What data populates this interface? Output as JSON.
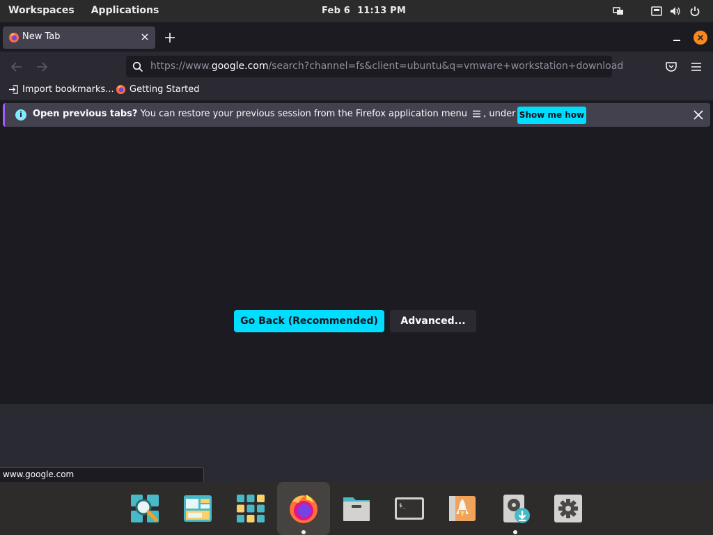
{
  "topbar": {
    "workspaces": "Workspaces",
    "applications": "Applications",
    "date": "Feb 6",
    "time": "11:13 PM"
  },
  "tab": {
    "title": "New Tab"
  },
  "urlbar": {
    "prefix": "https://www.",
    "host": "google.com",
    "path": "/search?channel=fs&client=ubuntu&q=vmware+workstation+download"
  },
  "bookmarks": {
    "import": "Import bookmarks...",
    "getting_started": "Getting Started"
  },
  "notice": {
    "bold": "Open previous tabs?",
    "text_before": " You can restore your previous session from the Firefox application menu ",
    "text_after": ", under History.",
    "button": "Show me how"
  },
  "content": {
    "go_back": "Go Back (Recommended)",
    "advanced": "Advanced..."
  },
  "status_url": "www.google.com",
  "colors": {
    "accent": "#00ddff",
    "window_close": "#f6891f"
  },
  "dock": {
    "items": [
      "search-app-icon",
      "workspaces-app-icon",
      "app-grid-icon",
      "firefox-icon",
      "files-icon",
      "terminal-icon",
      "app-launcher-rocket-icon",
      "software-installer-icon",
      "settings-icon"
    ]
  }
}
